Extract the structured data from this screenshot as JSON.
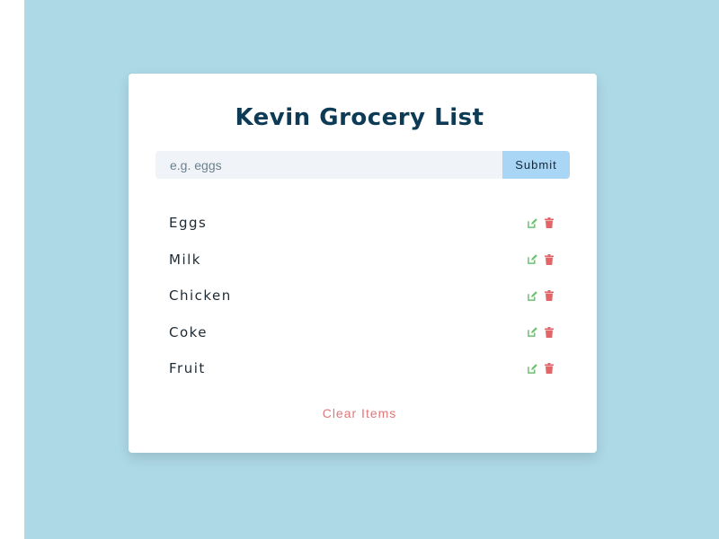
{
  "app": {
    "title": "Kevin Grocery List"
  },
  "form": {
    "placeholder": "e.g. eggs",
    "value": "",
    "submit_label": "Submit"
  },
  "items": [
    {
      "label": "Eggs"
    },
    {
      "label": "Milk"
    },
    {
      "label": "Chicken"
    },
    {
      "label": "Coke"
    },
    {
      "label": "Fruit"
    }
  ],
  "clear_label": "Clear Items",
  "icons": {
    "edit": "edit-icon",
    "delete": "trash-icon"
  },
  "colors": {
    "background": "#add8e6",
    "card": "#ffffff",
    "title": "#0d3b55",
    "submit_bg": "#a9d6f5",
    "edit": "#6cc070",
    "delete": "#e0666a",
    "clear": "#e0777a"
  }
}
